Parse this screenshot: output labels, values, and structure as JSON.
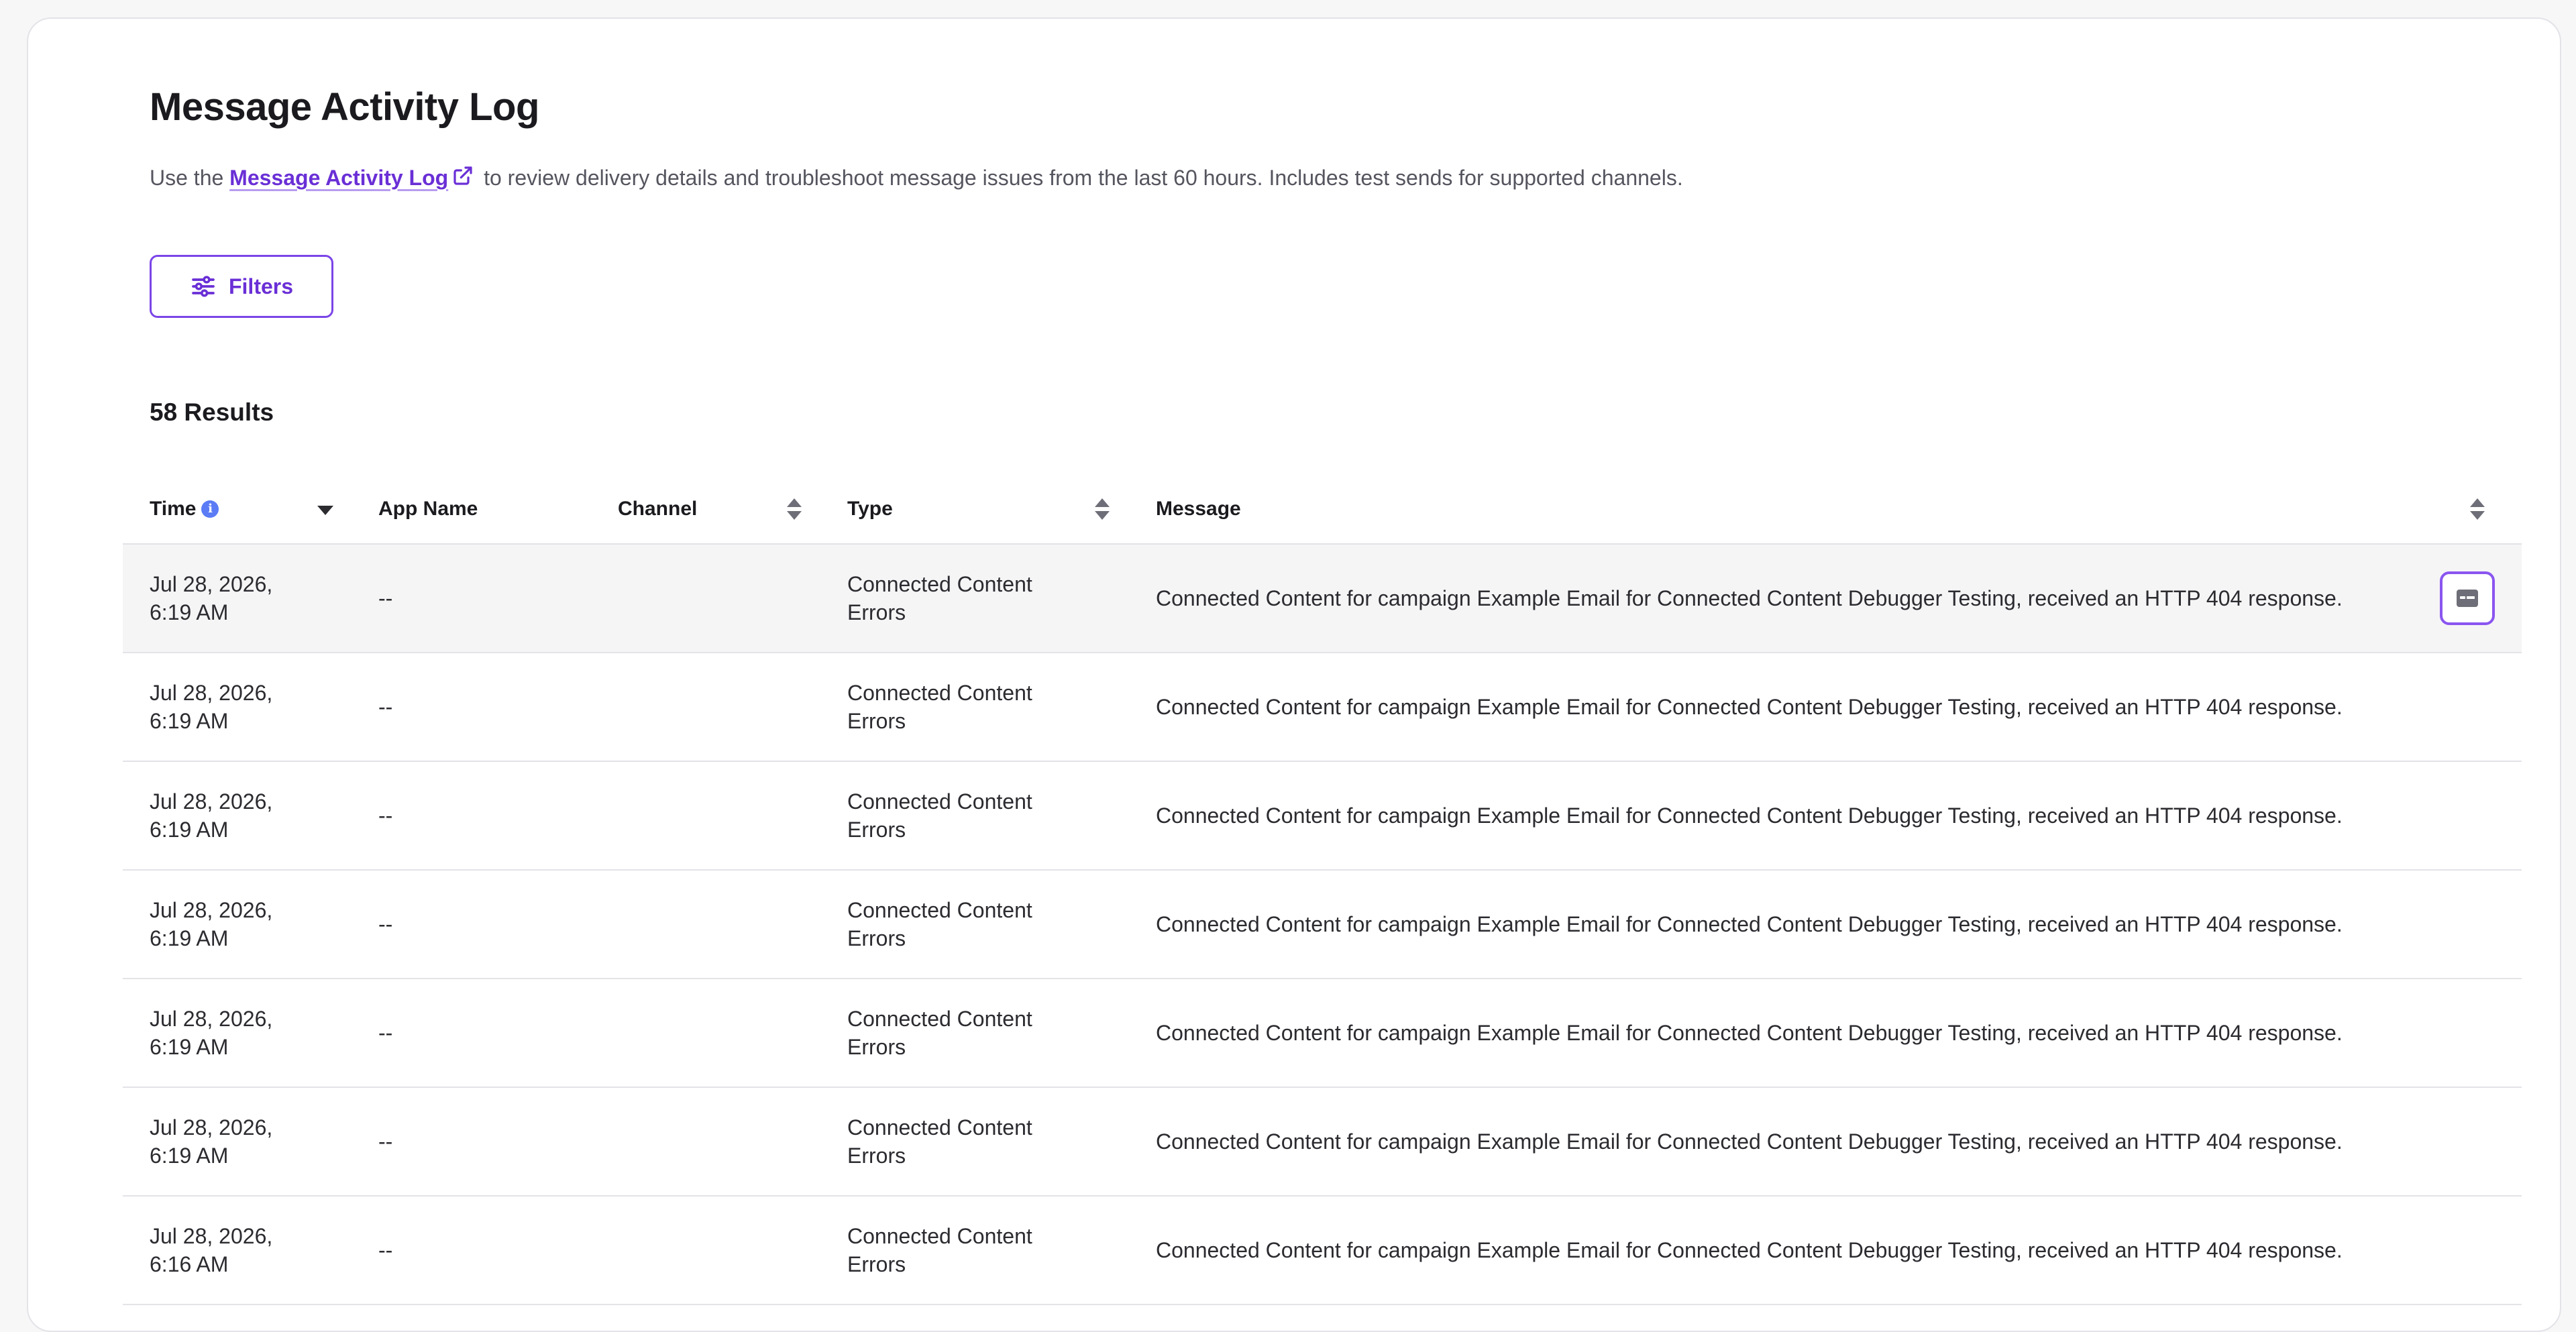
{
  "page": {
    "title": "Message Activity Log",
    "description_prefix": "Use the",
    "description_link": "Message Activity Log",
    "description_suffix": "to review delivery details and troubleshoot message issues from the last 60 hours. Includes test sends for supported channels."
  },
  "filters_button": {
    "label": "Filters"
  },
  "results_label": "58 Results",
  "table": {
    "headers": {
      "time": "Time",
      "app_name": "App Name",
      "channel": "Channel",
      "type": "Type",
      "message": "Message"
    },
    "rows": [
      {
        "time_date": "Jul 28, 2026,",
        "time_clock": "6:19 AM",
        "app_name": "--",
        "channel": "",
        "type_line1": "Connected Content",
        "type_line2": "Errors",
        "message": "Connected Content for campaign Example Email for Connected Content Debugger Testing, received an HTTP 404 response."
      },
      {
        "time_date": "Jul 28, 2026,",
        "time_clock": "6:19 AM",
        "app_name": "--",
        "channel": "",
        "type_line1": "Connected Content",
        "type_line2": "Errors",
        "message": "Connected Content for campaign Example Email for Connected Content Debugger Testing, received an HTTP 404 response."
      },
      {
        "time_date": "Jul 28, 2026,",
        "time_clock": "6:19 AM",
        "app_name": "--",
        "channel": "",
        "type_line1": "Connected Content",
        "type_line2": "Errors",
        "message": "Connected Content for campaign Example Email for Connected Content Debugger Testing, received an HTTP 404 response."
      },
      {
        "time_date": "Jul 28, 2026,",
        "time_clock": "6:19 AM",
        "app_name": "--",
        "channel": "",
        "type_line1": "Connected Content",
        "type_line2": "Errors",
        "message": "Connected Content for campaign Example Email for Connected Content Debugger Testing, received an HTTP 404 response."
      },
      {
        "time_date": "Jul 28, 2026,",
        "time_clock": "6:19 AM",
        "app_name": "--",
        "channel": "",
        "type_line1": "Connected Content",
        "type_line2": "Errors",
        "message": "Connected Content for campaign Example Email for Connected Content Debugger Testing, received an HTTP 404 response."
      },
      {
        "time_date": "Jul 28, 2026,",
        "time_clock": "6:19 AM",
        "app_name": "--",
        "channel": "",
        "type_line1": "Connected Content",
        "type_line2": "Errors",
        "message": "Connected Content for campaign Example Email for Connected Content Debugger Testing, received an HTTP 404 response."
      },
      {
        "time_date": "Jul 28, 2026,",
        "time_clock": "6:16 AM",
        "app_name": "--",
        "channel": "",
        "type_line1": "Connected Content",
        "type_line2": "Errors",
        "message": "Connected Content for campaign Example Email for Connected Content Debugger Testing, received an HTTP 404 response."
      }
    ]
  },
  "colors": {
    "accent": "#6a2fd6",
    "info": "#5b7cf5",
    "border": "#e3e3e8",
    "hover_row": "#f5f5f6"
  },
  "icons": {
    "external_link": "external-link-icon",
    "filters": "sliders-icon",
    "info": "info-icon",
    "sort": "sort-icon",
    "sort_desc": "sort-descending-icon",
    "row_action": "view-details-icon"
  }
}
